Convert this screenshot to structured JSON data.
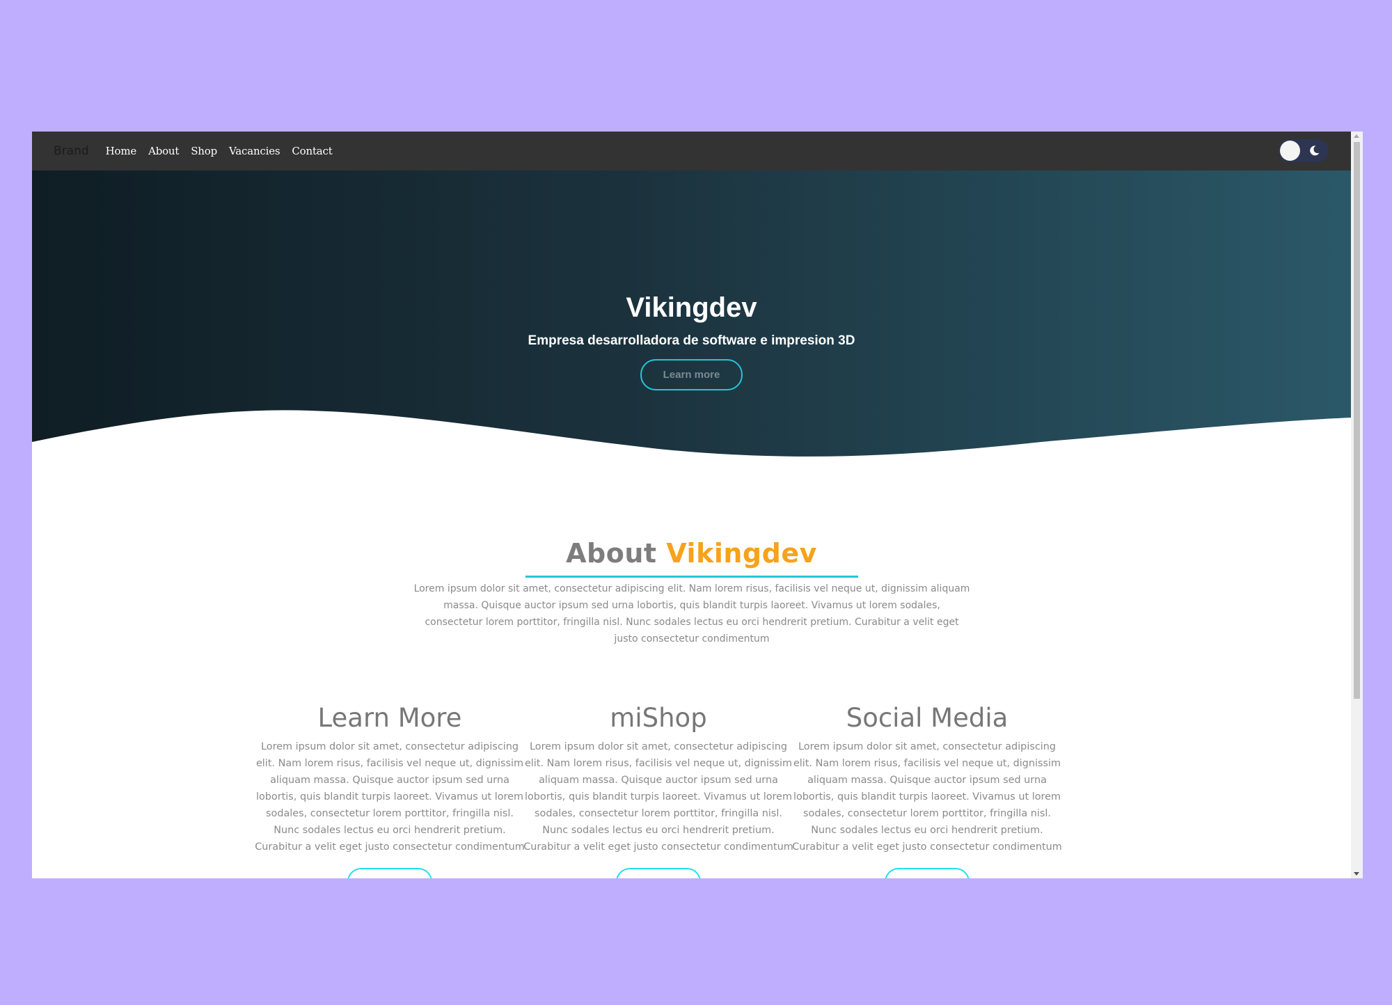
{
  "navbar": {
    "brand": "Brand",
    "links": [
      "Home",
      "About",
      "Shop",
      "Vacancies",
      "Contact"
    ]
  },
  "theme_toggle": {
    "icon": "moon-icon",
    "track_color": "#2e3552"
  },
  "hero": {
    "title": "Vikingdev",
    "subtitle": "Empresa desarrolladora de software e impresion 3D",
    "button_label": "Learn more",
    "gradient": [
      "#0f1d24",
      "#2b5868"
    ],
    "accent": "#23c7d6"
  },
  "about": {
    "title_prefix": "About",
    "title_brand": "Vikingdev",
    "brand_color": "#f7a21b",
    "text": "Lorem ipsum dolor sit amet, consectetur adipiscing elit. Nam lorem risus, facilisis vel neque ut, dignissim aliquam massa. Quisque auctor ipsum sed urna lobortis, quis blandit turpis laoreet. Vivamus ut lorem sodales, consectetur lorem porttitor, fringilla nisl. Nunc sodales lectus eu orci hendrerit pretium. Curabitur a velit eget justo consectetur condimentum"
  },
  "cards": [
    {
      "title": "Learn More",
      "text": "Lorem ipsum dolor sit amet, consectetur adipiscing elit. Nam lorem risus, facilisis vel neque ut, dignissim aliquam massa. Quisque auctor ipsum sed urna lobortis, quis blandit turpis laoreet. Vivamus ut lorem sodales, consectetur lorem porttitor, fringilla nisl. Nunc sodales lectus eu orci hendrerit pretium. Curabitur a velit eget justo consectetur condimentum"
    },
    {
      "title": "miShop",
      "text": "Lorem ipsum dolor sit amet, consectetur adipiscing elit. Nam lorem risus, facilisis vel neque ut, dignissim aliquam massa. Quisque auctor ipsum sed urna lobortis, quis blandit turpis laoreet. Vivamus ut lorem sodales, consectetur lorem porttitor, fringilla nisl. Nunc sodales lectus eu orci hendrerit pretium. Curabitur a velit eget justo consectetur condimentum"
    },
    {
      "title": "Social Media",
      "text": "Lorem ipsum dolor sit amet, consectetur adipiscing elit. Nam lorem risus, facilisis vel neque ut, dignissim aliquam massa. Quisque auctor ipsum sed urna lobortis, quis blandit turpis laoreet. Vivamus ut lorem sodales, consectetur lorem porttitor, fringilla nisl. Nunc sodales lectus eu orci hendrerit pretium. Curabitur a velit eget justo consectetur condimentum"
    }
  ],
  "colors": {
    "page_background": "#bfaefe",
    "navbar": "#333333",
    "card_button_border": "#23e0f0"
  }
}
